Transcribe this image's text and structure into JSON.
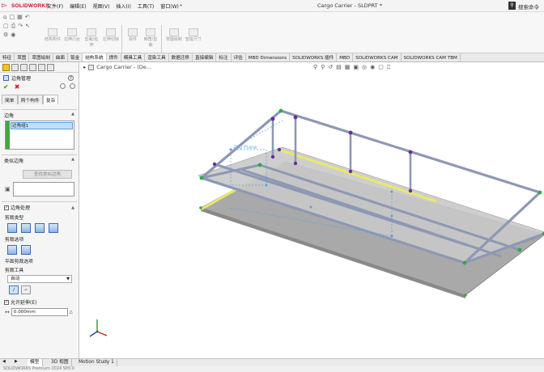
{
  "app": {
    "logo_text": "SOLIDWORKS",
    "document_title": "Cargo Carrier - SLDPRT *",
    "search_label": "搜索命令"
  },
  "menu": [
    "文件(F)",
    "编辑(E)",
    "视图(V)",
    "插入(I)",
    "工具(T)",
    "窗口(W)"
  ],
  "toolbar_buttons": [
    {
      "label": "结构构件"
    },
    {
      "label": "拉伸凸台"
    },
    {
      "label": "剪裁/延伸"
    },
    {
      "label": "拉伸切除"
    },
    {
      "label": "焊件"
    },
    {
      "label": "倒角/剪裁"
    },
    {
      "label": "草图绘制"
    },
    {
      "label": "智能尺寸"
    }
  ],
  "command_tabs": [
    "特征",
    "草图",
    "草图绘制",
    "曲面",
    "钣金",
    "结构系统",
    "焊件",
    "模具工具",
    "渲染工具",
    "数据迁移",
    "直接编辑",
    "标注",
    "评估",
    "MBD Dimensions",
    "SOLIDWORKS 插件",
    "MBD",
    "SOLIDWORKS CAM",
    "SOLIDWORKS CAM TBM"
  ],
  "active_command_tab": "结构系统",
  "property_manager": {
    "title": "边角管理",
    "subtabs": [
      "简单",
      "两个构件",
      "复杂"
    ],
    "active_subtab": "复杂",
    "corner_section": {
      "title": "边角",
      "selected_item": "边角组1"
    },
    "similar_section": {
      "title": "类似边角",
      "button": "查找类似边角"
    },
    "treatment_section": {
      "title": "边角处理",
      "trim_type_label": "剪裁类型",
      "trim_options_label": "剪裁选项",
      "planar_trim_label": "平面剪裁选项",
      "trim_tool_label": "剪裁工具",
      "trim_tool_value": "自动",
      "allow_extend_label": "允许延伸(E)",
      "gap_value": "0.000mm"
    }
  },
  "graphics": {
    "breadcrumb": "Cargo Carrier - (De..."
  },
  "bottom_tabs": [
    "模型",
    "3D 视图",
    "Motion Study 1"
  ],
  "active_bottom_tab": "模型",
  "status_text": "SOLIDWORKS Premium 2024 SP0.0"
}
